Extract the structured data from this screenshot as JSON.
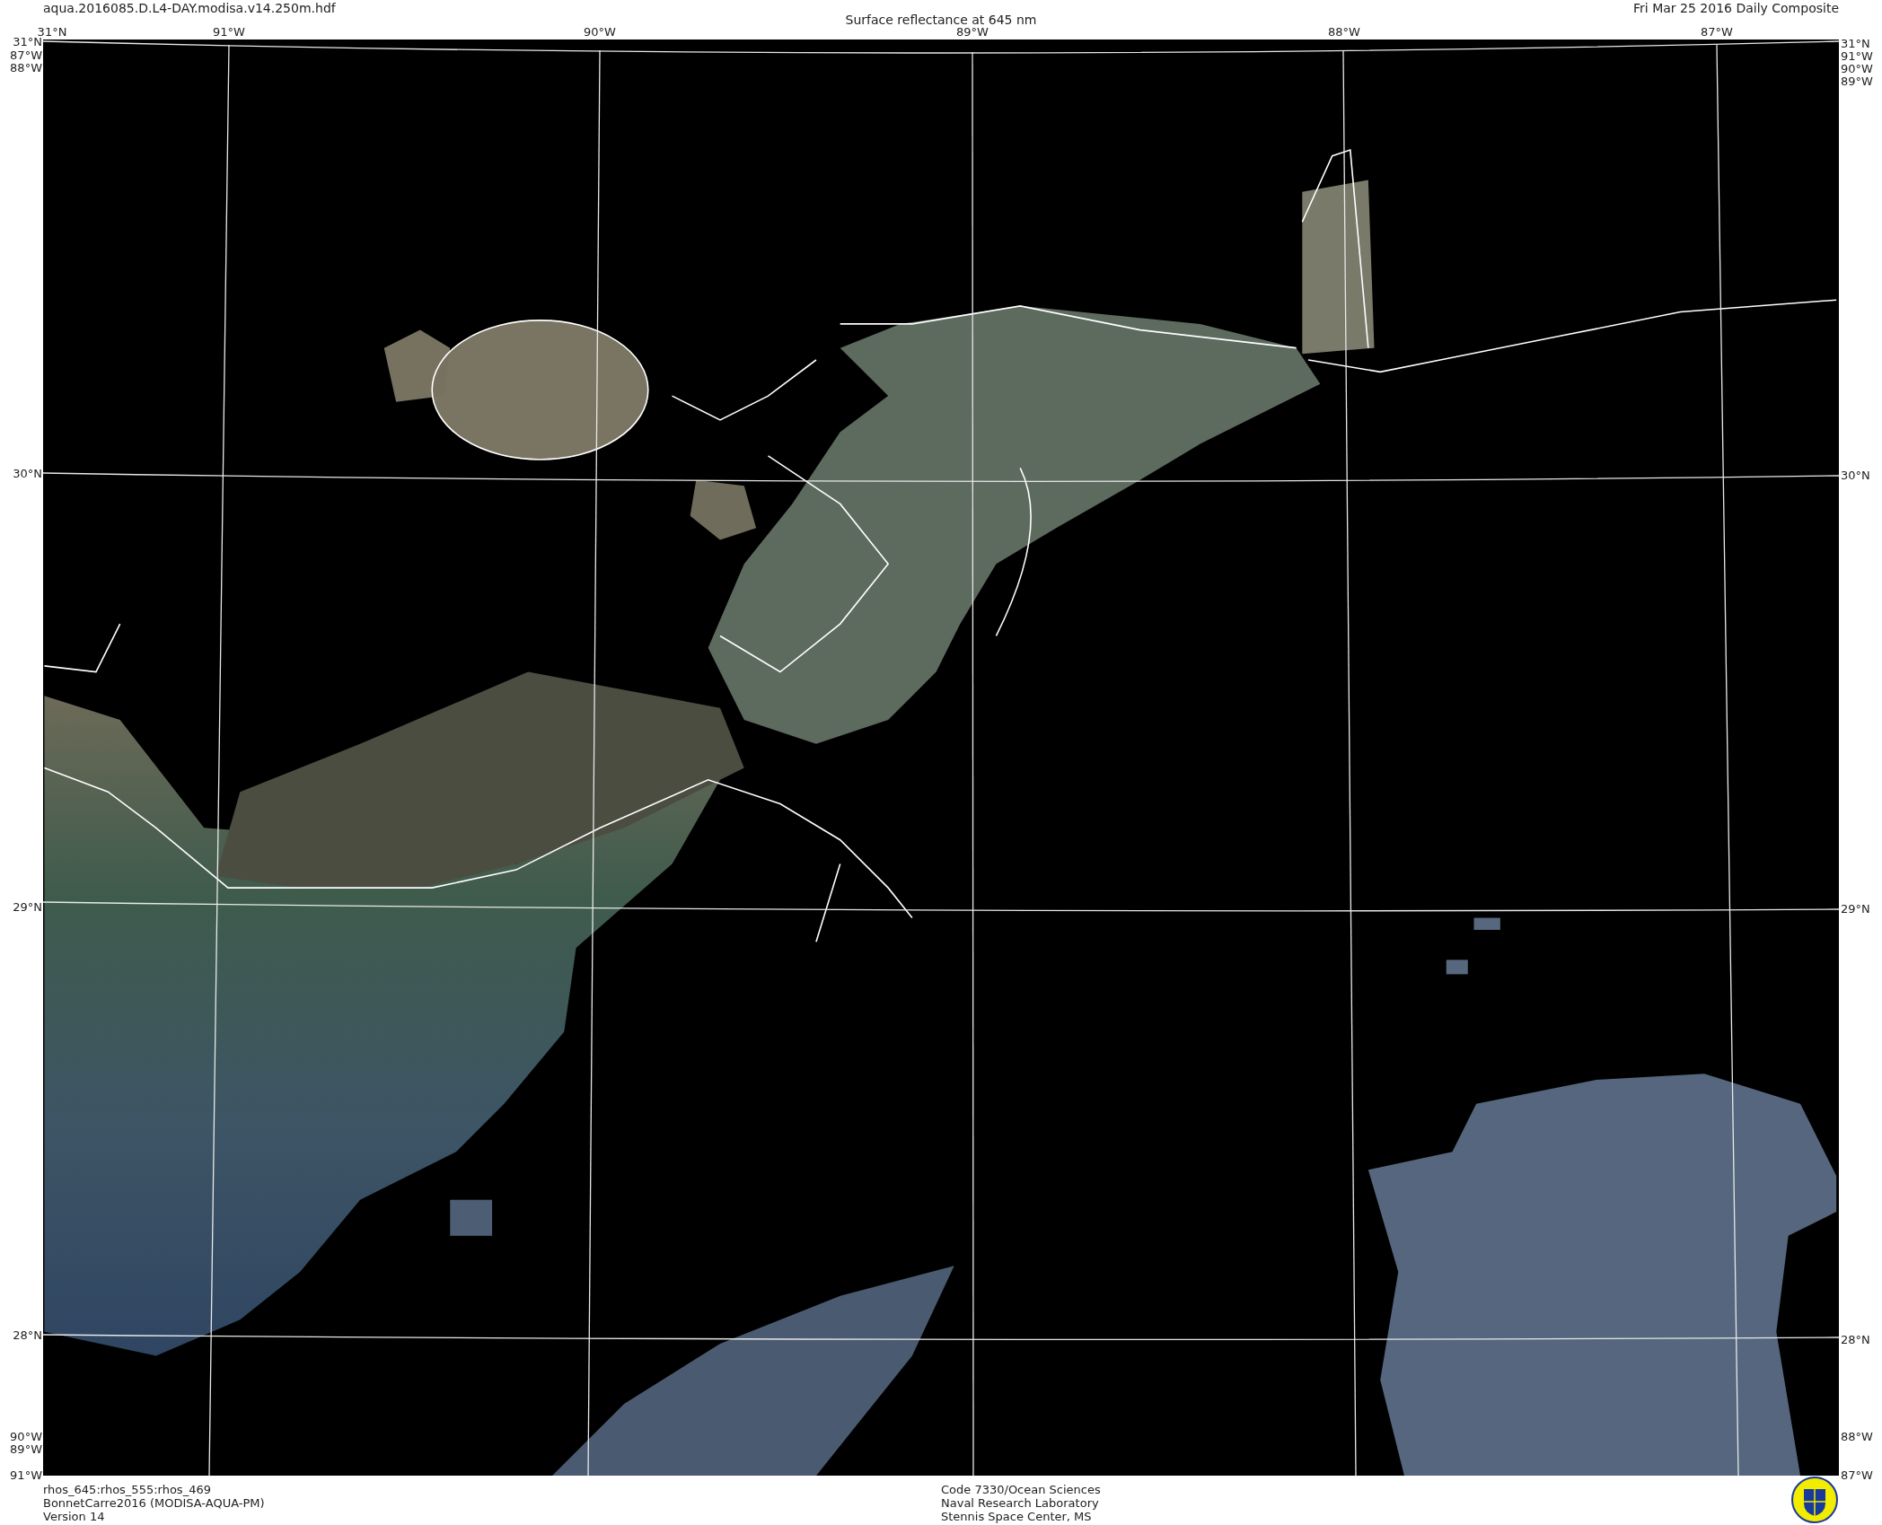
{
  "header": {
    "filename": "aqua.2016085.D.L4-DAY.modisa.v14.250m.hdf",
    "title": "Surface reflectance at 645 nm",
    "date": "Fri Mar 25 2016 Daily Composite"
  },
  "map": {
    "top_labels": [
      "31°N",
      "91°W",
      "90°W",
      "89°W",
      "88°W",
      "87°W"
    ],
    "left_labels": [
      "31°N",
      "87°W",
      "88°W",
      "30°N",
      "29°N",
      "28°N",
      "90°W",
      "89°W",
      "91°W"
    ],
    "right_labels": [
      "31°N",
      "91°W",
      "90°W",
      "89°W",
      "30°N",
      "29°N",
      "28°N",
      "88°W",
      "87°W"
    ]
  },
  "footer": {
    "left_lines": [
      "rhos_645:rhos_555:rhos_469",
      "BonnetCarre2016 (MODISA-AQUA-PM)",
      "Version 14"
    ],
    "center_lines": [
      "Code 7330/Ocean Sciences",
      "Naval Research Laboratory",
      "Stennis Space Center, MS"
    ]
  }
}
